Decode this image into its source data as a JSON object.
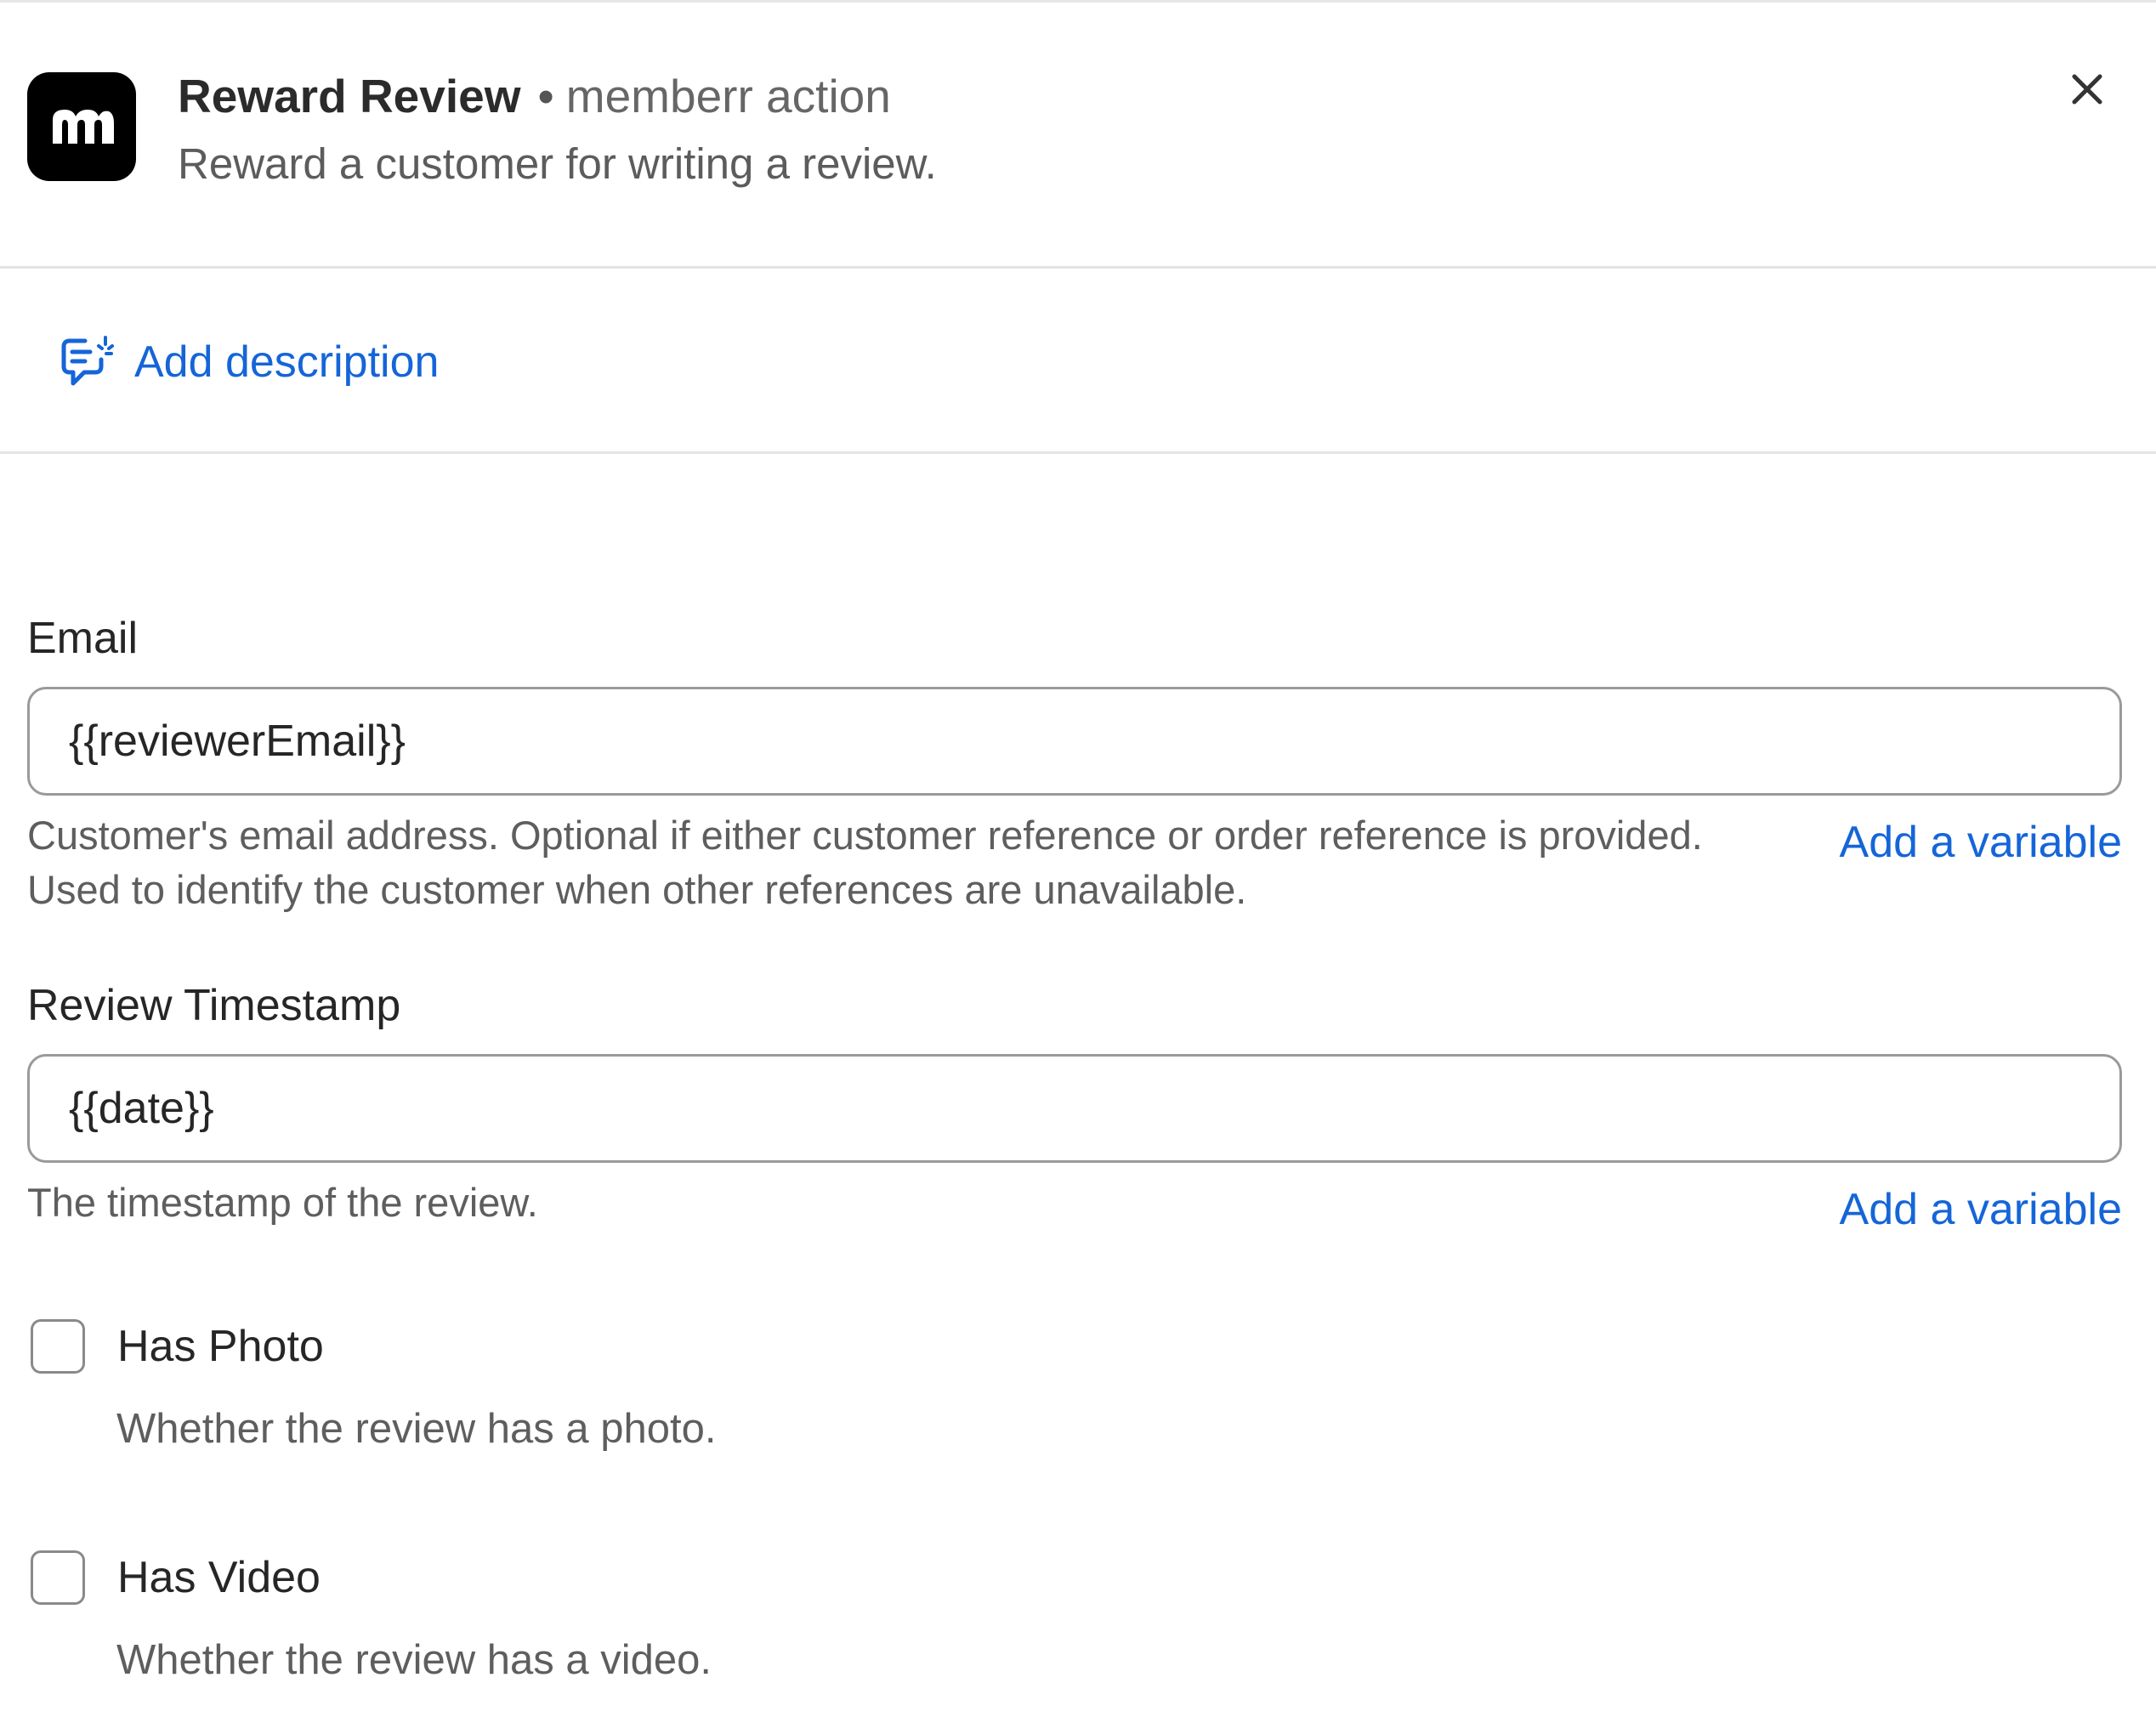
{
  "header": {
    "app_name": "Reward Review",
    "separator": "•",
    "app_type": "memberr action",
    "subtitle": "Reward a customer for writing a review.",
    "logo_icon": "memberr-logo-icon",
    "close_icon": "close-icon"
  },
  "description": {
    "label": "Add description",
    "icon": "comment-edit-icon",
    "color": "#1565d8"
  },
  "fields": {
    "email": {
      "label": "Email",
      "value": "{{reviewerEmail}}",
      "help": "Customer's email address. Optional if either customer reference or order reference is provided. Used to identify the customer when other references are unavailable.",
      "add_variable": "Add a variable"
    },
    "review_timestamp": {
      "label": "Review Timestamp",
      "value": "{{date}}",
      "help": "The timestamp of the review.",
      "add_variable": "Add a variable"
    }
  },
  "checkboxes": {
    "has_photo": {
      "label": "Has Photo",
      "help": "Whether the review has a photo.",
      "checked": false
    },
    "has_video": {
      "label": "Has Video",
      "help": "Whether the review has a video.",
      "checked": false
    }
  }
}
